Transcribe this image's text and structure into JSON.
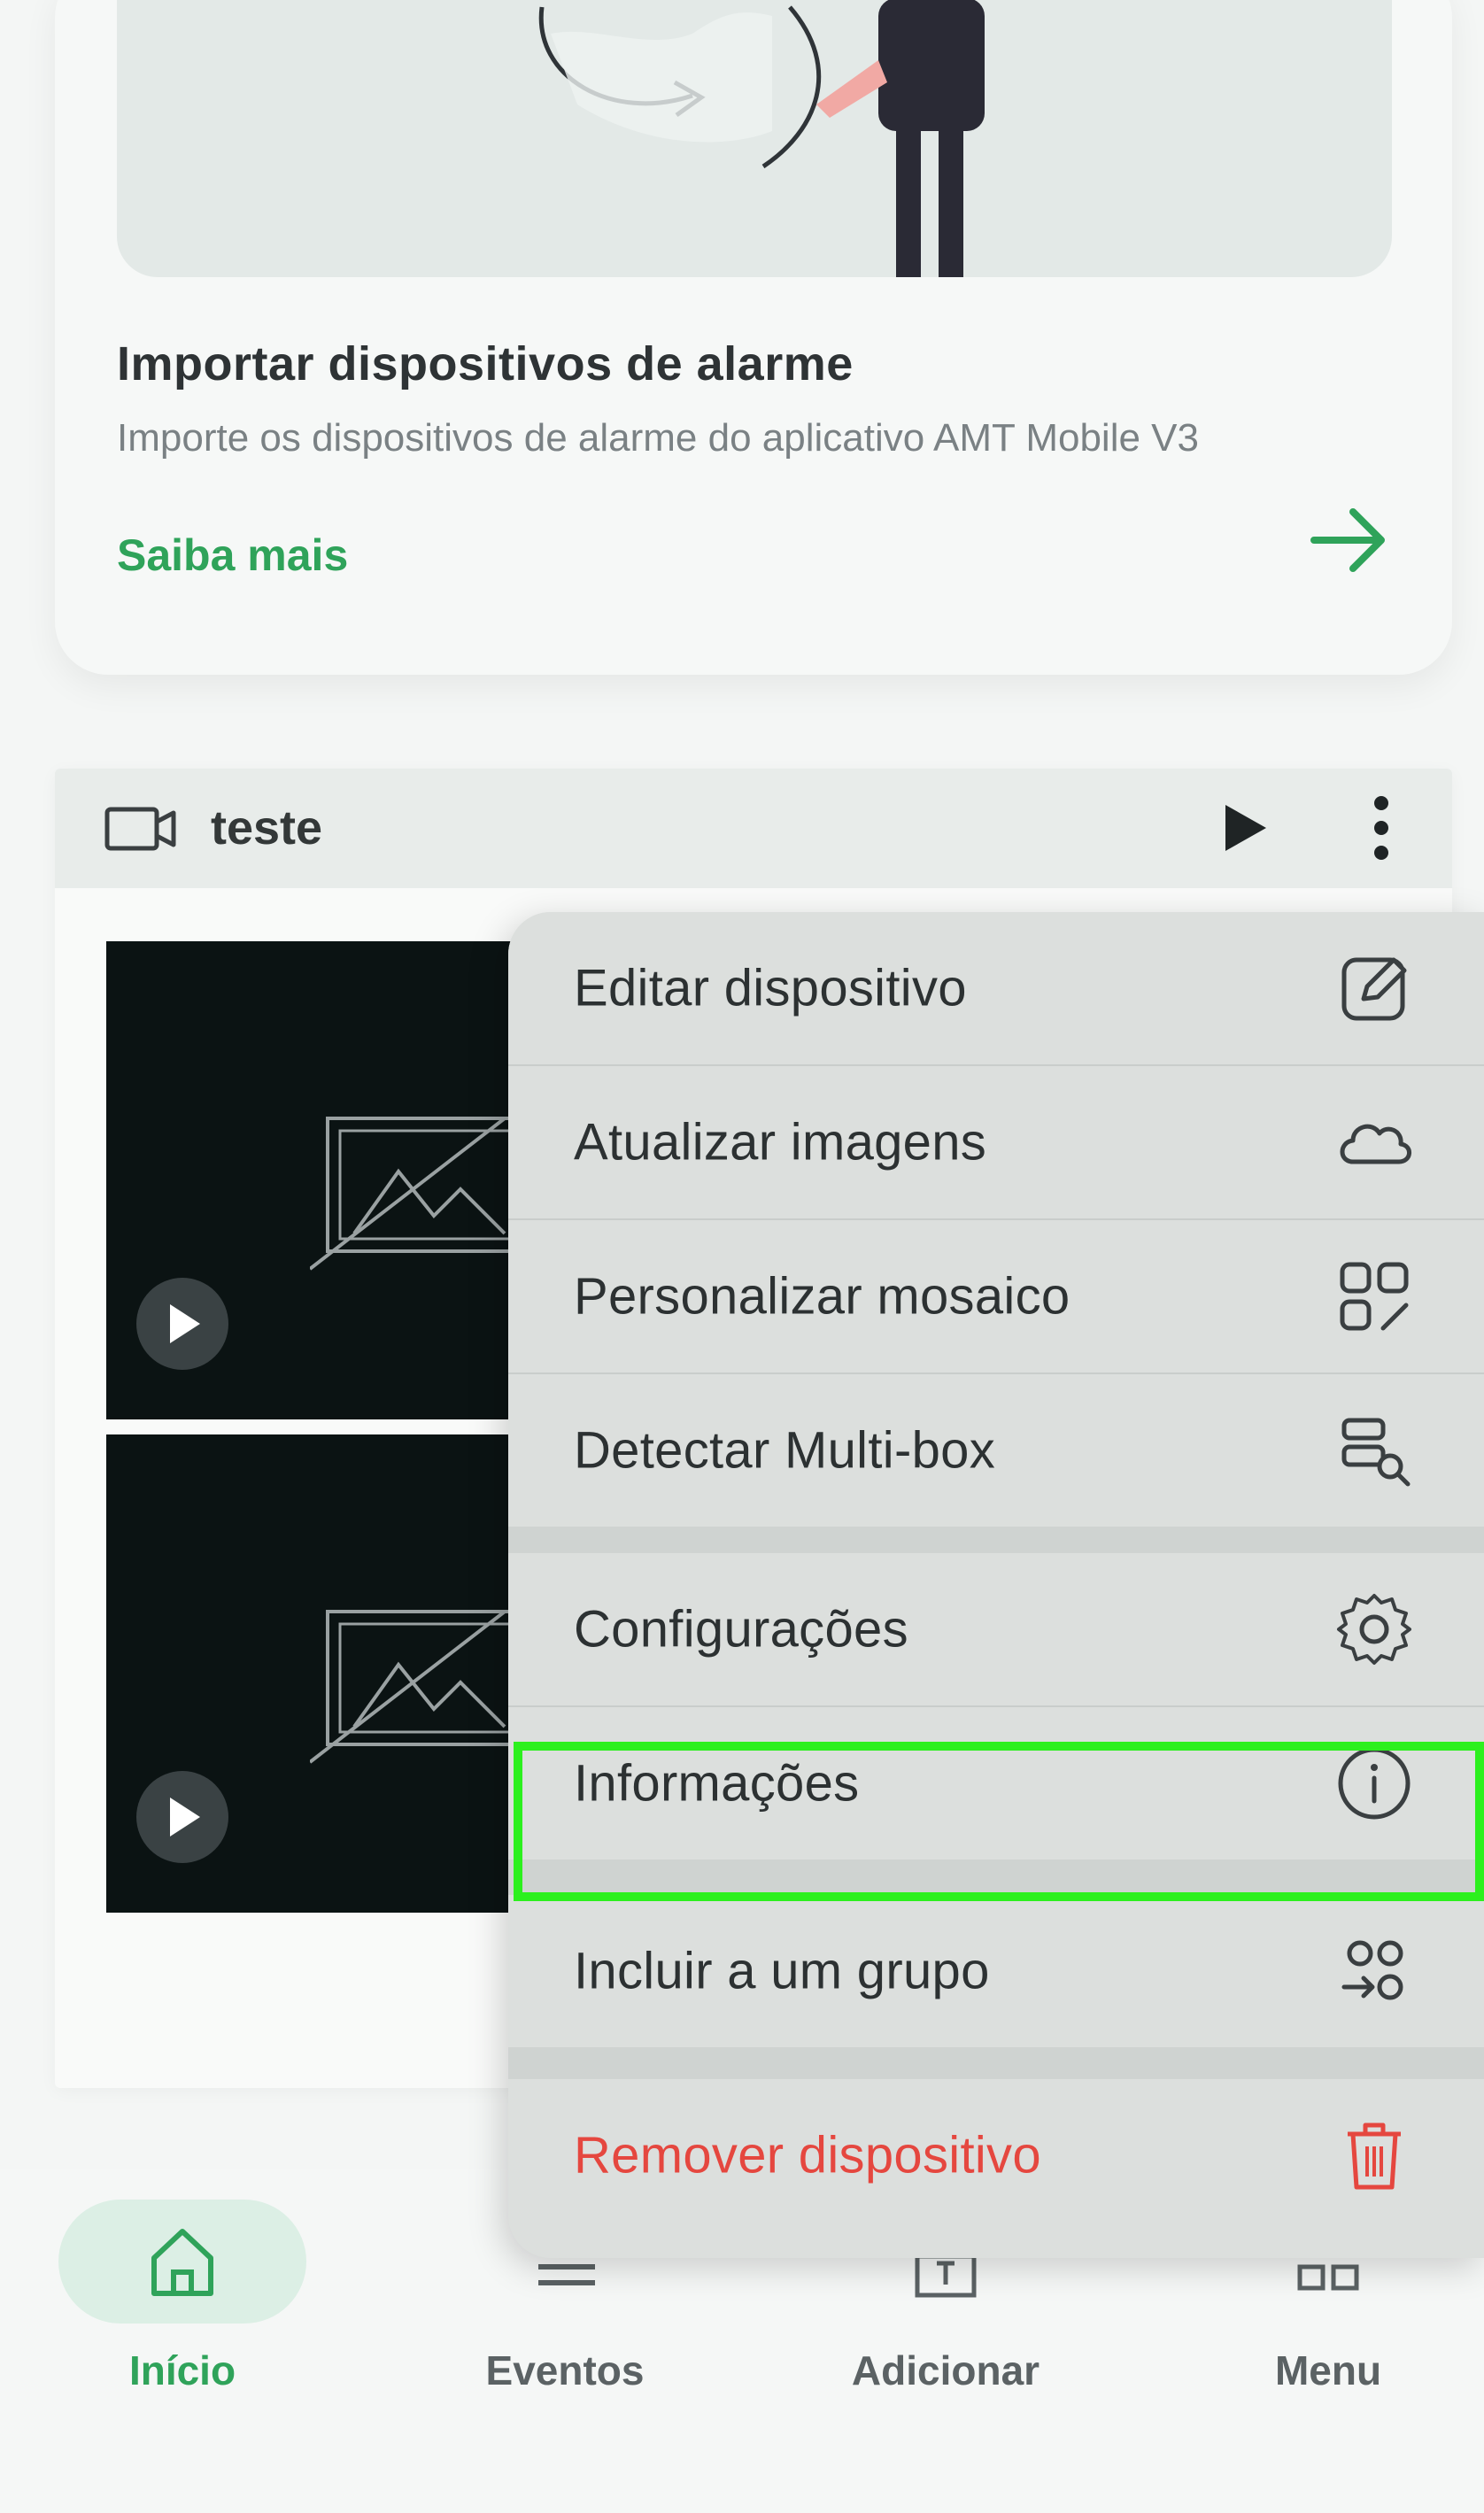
{
  "promo": {
    "title": "Importar dispositivos de alarme",
    "description": "Importe os dispositivos de alarme do aplicativo AMT Mobile V3",
    "link_label": "Saiba mais"
  },
  "device": {
    "name": "teste"
  },
  "context_menu": {
    "items": [
      {
        "label": "Editar dispositivo",
        "icon": "edit-icon"
      },
      {
        "label": "Atualizar imagens",
        "icon": "cloud-icon"
      },
      {
        "label": "Personalizar mosaico",
        "icon": "mosaic-icon"
      },
      {
        "label": "Detectar Multi-box",
        "icon": "detect-icon"
      },
      {
        "label": "Configurações",
        "icon": "gear-icon"
      },
      {
        "label": "Informações",
        "icon": "info-icon"
      },
      {
        "label": "Incluir a um grupo",
        "icon": "group-add-icon"
      },
      {
        "label": "Remover dispositivo",
        "icon": "trash-icon"
      }
    ],
    "highlighted": "Informações"
  },
  "bottom_nav": {
    "items": [
      {
        "label": "Início",
        "icon": "home-icon",
        "active": true
      },
      {
        "label": "Eventos",
        "icon": "events-icon",
        "active": false
      },
      {
        "label": "Adicionar",
        "icon": "add-icon",
        "active": false
      },
      {
        "label": "Menu",
        "icon": "menu-icon",
        "active": false
      }
    ]
  },
  "colors": {
    "accent": "#2fa35a",
    "danger": "#e5473f",
    "highlight": "#2cf01e"
  }
}
